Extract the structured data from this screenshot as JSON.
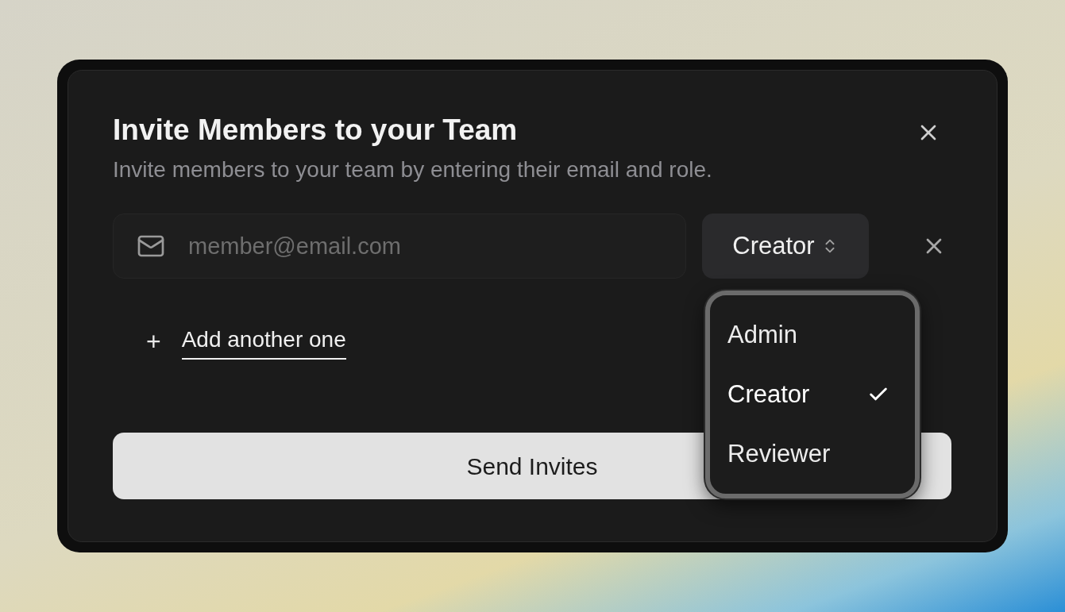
{
  "dialog": {
    "title": "Invite Members to your Team",
    "description": "Invite members to your team by entering their email and role."
  },
  "invite_row": {
    "email": {
      "placeholder": "member@email.com"
    },
    "role_select": {
      "value": "Creator",
      "expanded": true,
      "options": [
        {
          "label": "Admin",
          "selected": false
        },
        {
          "label": "Creator",
          "selected": true
        },
        {
          "label": "Reviewer",
          "selected": false
        }
      ]
    }
  },
  "add_link": {
    "icon": "+",
    "label": "Add another one"
  },
  "submit": {
    "label": "Send Invites"
  }
}
